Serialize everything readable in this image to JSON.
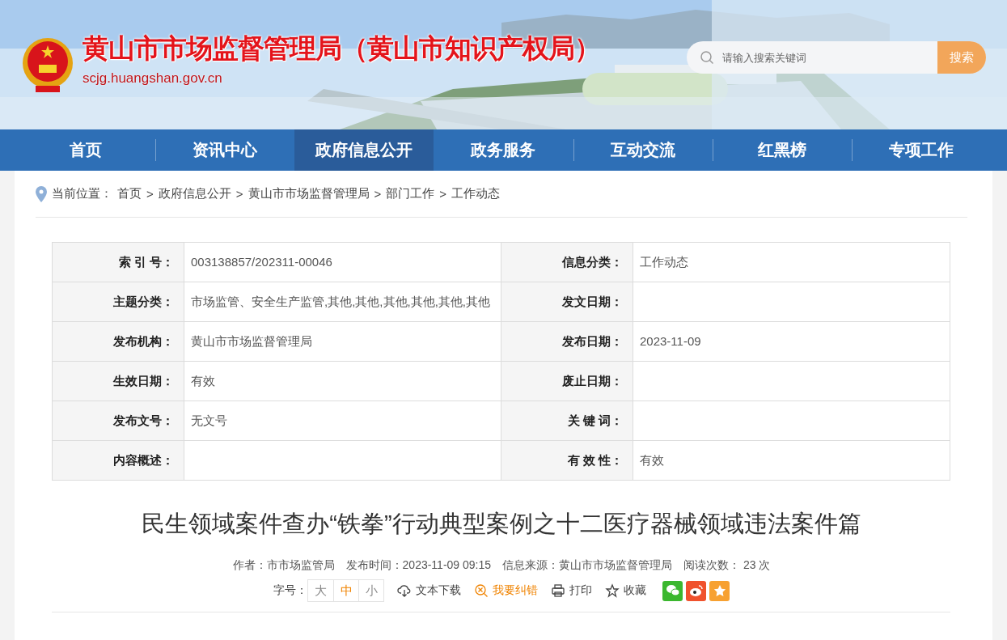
{
  "header": {
    "title": "黄山市市场监督管理局（黄山市知识产权局）",
    "domain": "scjg.huangshan.gov.cn",
    "search": {
      "placeholder": "请输入搜索关键词",
      "button": "搜索"
    }
  },
  "nav": [
    {
      "label": "首页",
      "selected": false
    },
    {
      "label": "资讯中心",
      "selected": false
    },
    {
      "label": "政府信息公开",
      "selected": true
    },
    {
      "label": "政务服务",
      "selected": false
    },
    {
      "label": "互动交流",
      "selected": false
    },
    {
      "label": "红黑榜",
      "selected": false
    },
    {
      "label": "专项工作",
      "selected": false
    }
  ],
  "breadcrumb": {
    "label": "当前位置：",
    "items": [
      "首页",
      "政府信息公开",
      "黄山市市场监督管理局",
      "部门工作",
      "工作动态"
    ],
    "separator": ">"
  },
  "info_table": [
    [
      {
        "label": "索 引 号：",
        "value": "003138857/202311-00046"
      },
      {
        "label": "信息分类：",
        "value": "工作动态"
      }
    ],
    [
      {
        "label": "主题分类：",
        "value": "市场监管、安全生产监管,其他,其他,其他,其他,其他,其他"
      },
      {
        "label": "发文日期："
      }
    ],
    [
      {
        "label": "发布机构：",
        "value": "黄山市市场监督管理局"
      },
      {
        "label": "发布日期：",
        "value": "2023-11-09"
      }
    ],
    [
      {
        "label": "生效日期：",
        "value": "有效"
      },
      {
        "label": "废止日期："
      }
    ],
    [
      {
        "label": "发布文号：",
        "value": "无文号"
      },
      {
        "label": "关 键 词："
      }
    ],
    [
      {
        "label": "内容概述："
      },
      {
        "label": "有 效 性：",
        "value": "有效"
      }
    ]
  ],
  "article": {
    "title": "民生领域案件查办“铁拳”行动典型案例之十二医疗器械领域违法案件篇",
    "meta": [
      "作者：市市场监管局",
      "发布时间：2023-11-09 09:15",
      "信息来源：黄山市市场监督管理局",
      "阅读次数： 23 次"
    ],
    "font_size": {
      "label": "字号：",
      "options": [
        {
          "label": "大",
          "selected": false
        },
        {
          "label": "中",
          "selected": true
        },
        {
          "label": "小",
          "selected": false
        }
      ]
    },
    "tools": [
      {
        "kind": "download",
        "label": "文本下载"
      },
      {
        "kind": "report",
        "label": "我要纠错"
      },
      {
        "kind": "print",
        "label": "打印"
      },
      {
        "kind": "favorite",
        "label": "收藏"
      }
    ],
    "share": [
      {
        "kind": "wechat",
        "color": "#3bb72f"
      },
      {
        "kind": "weibo",
        "color": "#f0522d"
      },
      {
        "kind": "qzone",
        "color": "#f7a131"
      }
    ]
  }
}
